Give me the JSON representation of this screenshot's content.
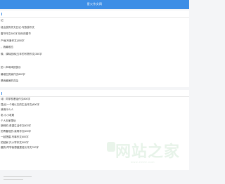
{
  "header": {
    "title": "星火作文网"
  },
  "section1": {
    "items": [
      "记",
      "段出游的作文日记-写旅游作文",
      "春节作文300字 快乐的春节",
      "产地(写景作文)350字",
      "，我最难忘",
      "像，调味品和(五年的写物作文)350字",
      "",
      "的一声母鸡的快乐",
      "最难忘的家作文800字",
      "是我最美的花朵",
      "跳-我的老师作文350字"
    ]
  },
  "section2": {
    "items": [
      "诗）同学校看话作文800字",
      "昆(记一个难以忘的生活作文)800字",
      "我用什么人",
      "老-小小收尾",
      "个人去家里玩",
      "新鲜的-希望生活作文800字",
      "的青春班的-我再作文600字",
      "一起搭建-写事作文600字",
      "的回家-只小学作文500字",
      "趣的-同学我想做是班长作文700字"
    ]
  },
  "watermark": {
    "main": "网站之家",
    "sub": "www.ZZZZ.com"
  }
}
